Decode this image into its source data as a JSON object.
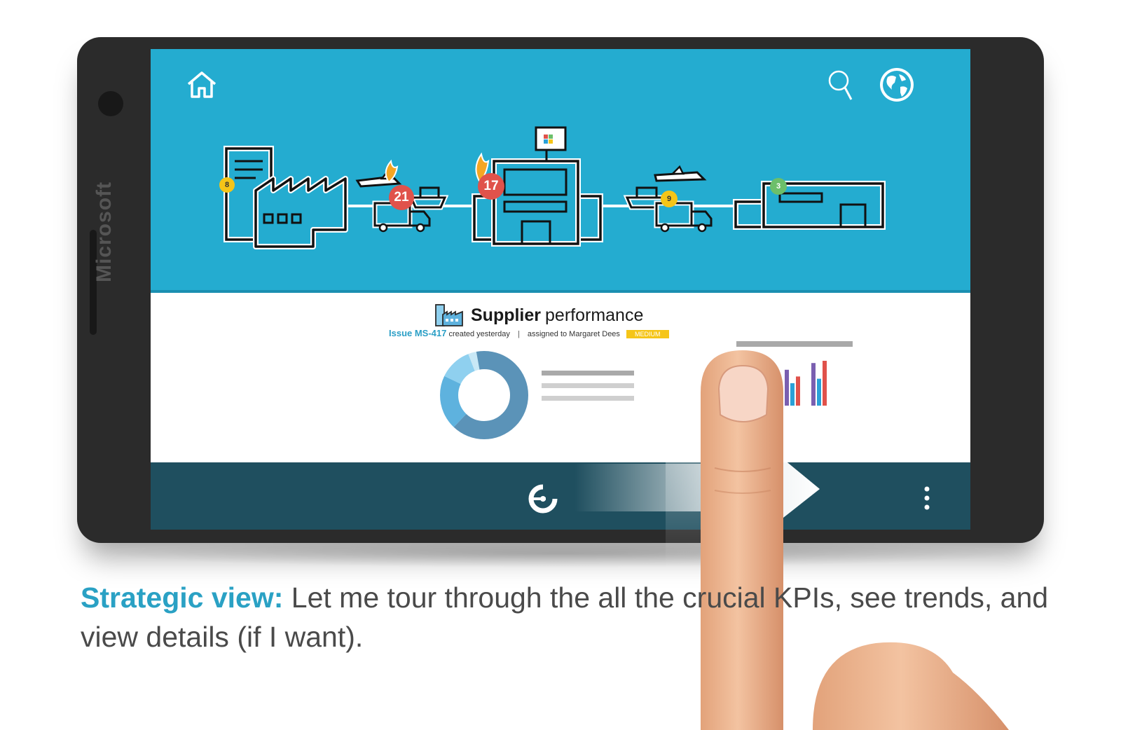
{
  "device": {
    "brand": "Microsoft"
  },
  "header": {
    "home_icon": "home-icon",
    "search_icon": "search-icon",
    "globe_icon": "globe-icon"
  },
  "supply_chain": {
    "nodes": [
      {
        "name": "supplier-factory",
        "badge": "8",
        "badge_color": "#f5c518"
      },
      {
        "name": "inbound-transport",
        "badge": "21",
        "badge_color": "#e0524b",
        "alert": "fire"
      },
      {
        "name": "headquarters",
        "badge": "17",
        "badge_color": "#e0524b",
        "alert": "fire"
      },
      {
        "name": "outbound-transport",
        "badge": "9",
        "badge_color": "#f5c518"
      },
      {
        "name": "warehouse",
        "badge": "3",
        "badge_color": "#6cbf6a"
      }
    ]
  },
  "card": {
    "title_bold": "Supplier",
    "title_rest": "performance",
    "issue_id": "Issue MS-417",
    "created": "created yesterday",
    "separator": "|",
    "assigned": "assigned to Margaret Dees",
    "priority": "MEDIUM",
    "priority_color": "#f5c518"
  },
  "donut": {
    "segments": [
      {
        "value": 0.62,
        "color": "#5b93b8"
      },
      {
        "value": 0.2,
        "color": "#5eb2de"
      },
      {
        "value": 0.12,
        "color": "#8fd0ef"
      },
      {
        "value": 0.03,
        "color": "#c8e8f6"
      },
      {
        "value": 0.03,
        "color": "#5b93b8"
      }
    ]
  },
  "mini_bars": {
    "groups": [
      [
        0.55,
        0.9,
        0.45
      ],
      [
        0.8,
        0.5,
        0.65
      ],
      [
        0.95,
        0.6,
        1.0
      ]
    ],
    "colors": [
      "#7a5fb0",
      "#2aa1d8",
      "#e0524b"
    ]
  },
  "footer": {
    "nav_icon": "cortana-icon",
    "more_icon": "more-vertical-icon"
  },
  "caption": {
    "lead": "Strategic view:",
    "text": " Let me tour through the all the crucial KPIs, see trends, and view details (if I want)."
  }
}
